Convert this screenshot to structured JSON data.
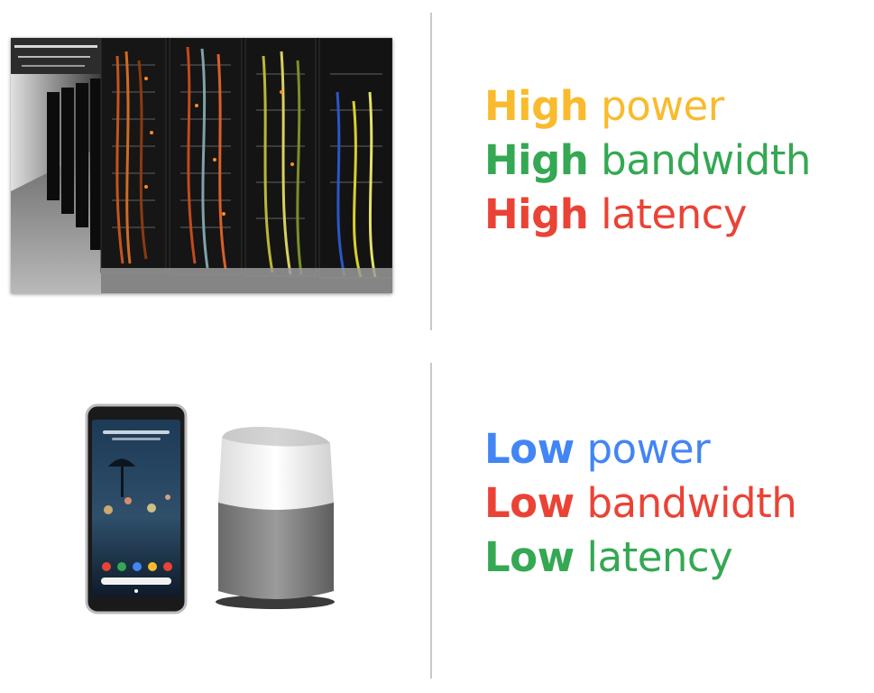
{
  "colors": {
    "yellow": "#F9BB2D",
    "green": "#34A853",
    "red": "#EA4335",
    "blue": "#4285F4"
  },
  "server_side": {
    "image": "datacenter-server-racks",
    "lines": [
      {
        "strong": "High",
        "rest": "power",
        "color": "#F9BB2D"
      },
      {
        "strong": "High",
        "rest": "bandwidth",
        "color": "#34A853"
      },
      {
        "strong": "High",
        "rest": "latency",
        "color": "#EA4335"
      }
    ]
  },
  "device_side": {
    "images": [
      "smartphone",
      "smart-speaker"
    ],
    "phone_screen_text": "Dinner with Layla in 30 min",
    "lines": [
      {
        "strong": "Low",
        "rest": "power",
        "color": "#4285F4"
      },
      {
        "strong": "Low",
        "rest": "bandwidth",
        "color": "#EA4335"
      },
      {
        "strong": "Low",
        "rest": "latency",
        "color": "#34A853"
      }
    ]
  }
}
